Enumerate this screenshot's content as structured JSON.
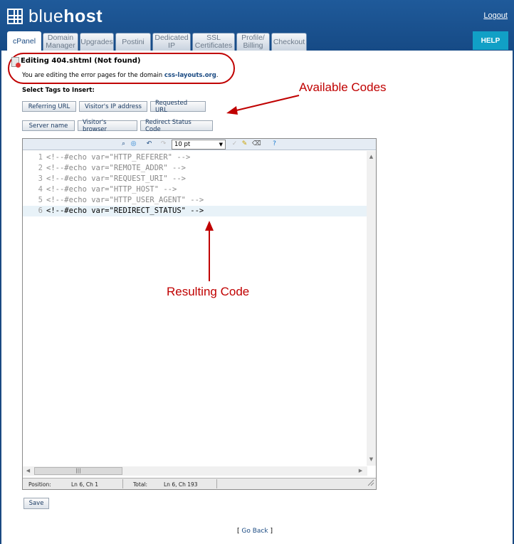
{
  "header": {
    "logo_light": "blue",
    "logo_bold": "host",
    "logout": "Logout",
    "help": "HELP"
  },
  "tabs": [
    {
      "label": "cPanel",
      "active": true
    },
    {
      "label": "Domain\nManager"
    },
    {
      "label": "Upgrades"
    },
    {
      "label": "Postini"
    },
    {
      "label": "Dedicated\nIP"
    },
    {
      "label": "SSL\nCertificates"
    },
    {
      "label": "Profile/\nBilling"
    },
    {
      "label": "Checkout"
    }
  ],
  "notice": {
    "title": "Editing 404.shtml (Not found)",
    "subtitle_prefix": "You are editing the error pages for the domain ",
    "domain": "css-layouts.org",
    "subtitle_suffix": "."
  },
  "tags": {
    "label": "Select Tags to Insert:",
    "buttons": [
      "Referring URL",
      "Visitor's IP address",
      "Requested URL",
      "Server name",
      "Visitor's browser",
      "Redirect Status Code"
    ]
  },
  "annotations": {
    "available": "Available Codes",
    "resulting": "Resulting Code"
  },
  "editor": {
    "font_size": "10 pt",
    "lines": [
      {
        "num": "1",
        "text": "<!--#echo var=\"HTTP_REFERER\" -->"
      },
      {
        "num": "2",
        "text": "<!--#echo var=\"REMOTE_ADDR\" -->"
      },
      {
        "num": "3",
        "text": "<!--#echo var=\"REQUEST_URI\" -->"
      },
      {
        "num": "4",
        "text": "<!--#echo var=\"HTTP_HOST\" -->"
      },
      {
        "num": "5",
        "text": "<!--#echo var=\"HTTP_USER_AGENT\" -->"
      },
      {
        "num": "6",
        "text": "<!--#echo var=\"REDIRECT_STATUS\" -->"
      }
    ],
    "status": {
      "position_label": "Position:",
      "position_value": "Ln 6, Ch 1",
      "total_label": "Total:",
      "total_value": "Ln 6, Ch 193"
    }
  },
  "save": "Save",
  "go_back": {
    "open": "[ ",
    "label": "Go Back",
    "close": " ]"
  },
  "colors": {
    "brand": "#1a4a82",
    "help": "#11a0c6",
    "annotation": "#c00000"
  }
}
